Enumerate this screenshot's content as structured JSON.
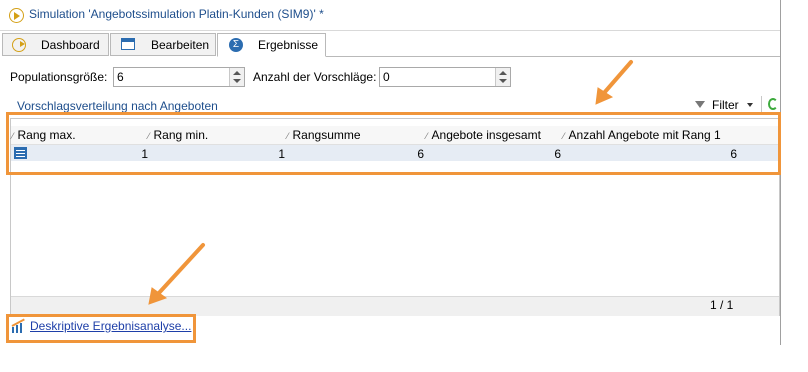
{
  "window": {
    "title": "Simulation 'Angebotssimulation Platin-Kunden (SIM9)' *"
  },
  "tabs": [
    {
      "label": "Dashboard",
      "icon": "play-icon",
      "active": false
    },
    {
      "label": "Bearbeiten",
      "icon": "form-icon",
      "active": false
    },
    {
      "label": "Ergebnisse",
      "icon": "sigma-icon",
      "active": true
    }
  ],
  "params": {
    "population_label": "Populationsgröße:",
    "population_value": "6",
    "suggestions_label": "Anzahl der Vorschläge:",
    "suggestions_value": "0"
  },
  "section": {
    "title": "Vorschlagsverteilung nach Angeboten",
    "filter_label": "Filter"
  },
  "table": {
    "columns": [
      "Rang max.",
      "Rang min.",
      "Rangsumme",
      "Angebote insgesamt",
      "Anzahl Angebote mit Rang 1"
    ],
    "rows": [
      [
        "1",
        "1",
        "6",
        "6",
        "6"
      ]
    ]
  },
  "pager": {
    "text": "1 / 1"
  },
  "bottom_link": {
    "label": "Deskriptive Ergebnisanalyse..."
  },
  "colors": {
    "accent": "#f0953a",
    "link": "#1e4e8c",
    "row_highlight": "#e6ecf4"
  }
}
